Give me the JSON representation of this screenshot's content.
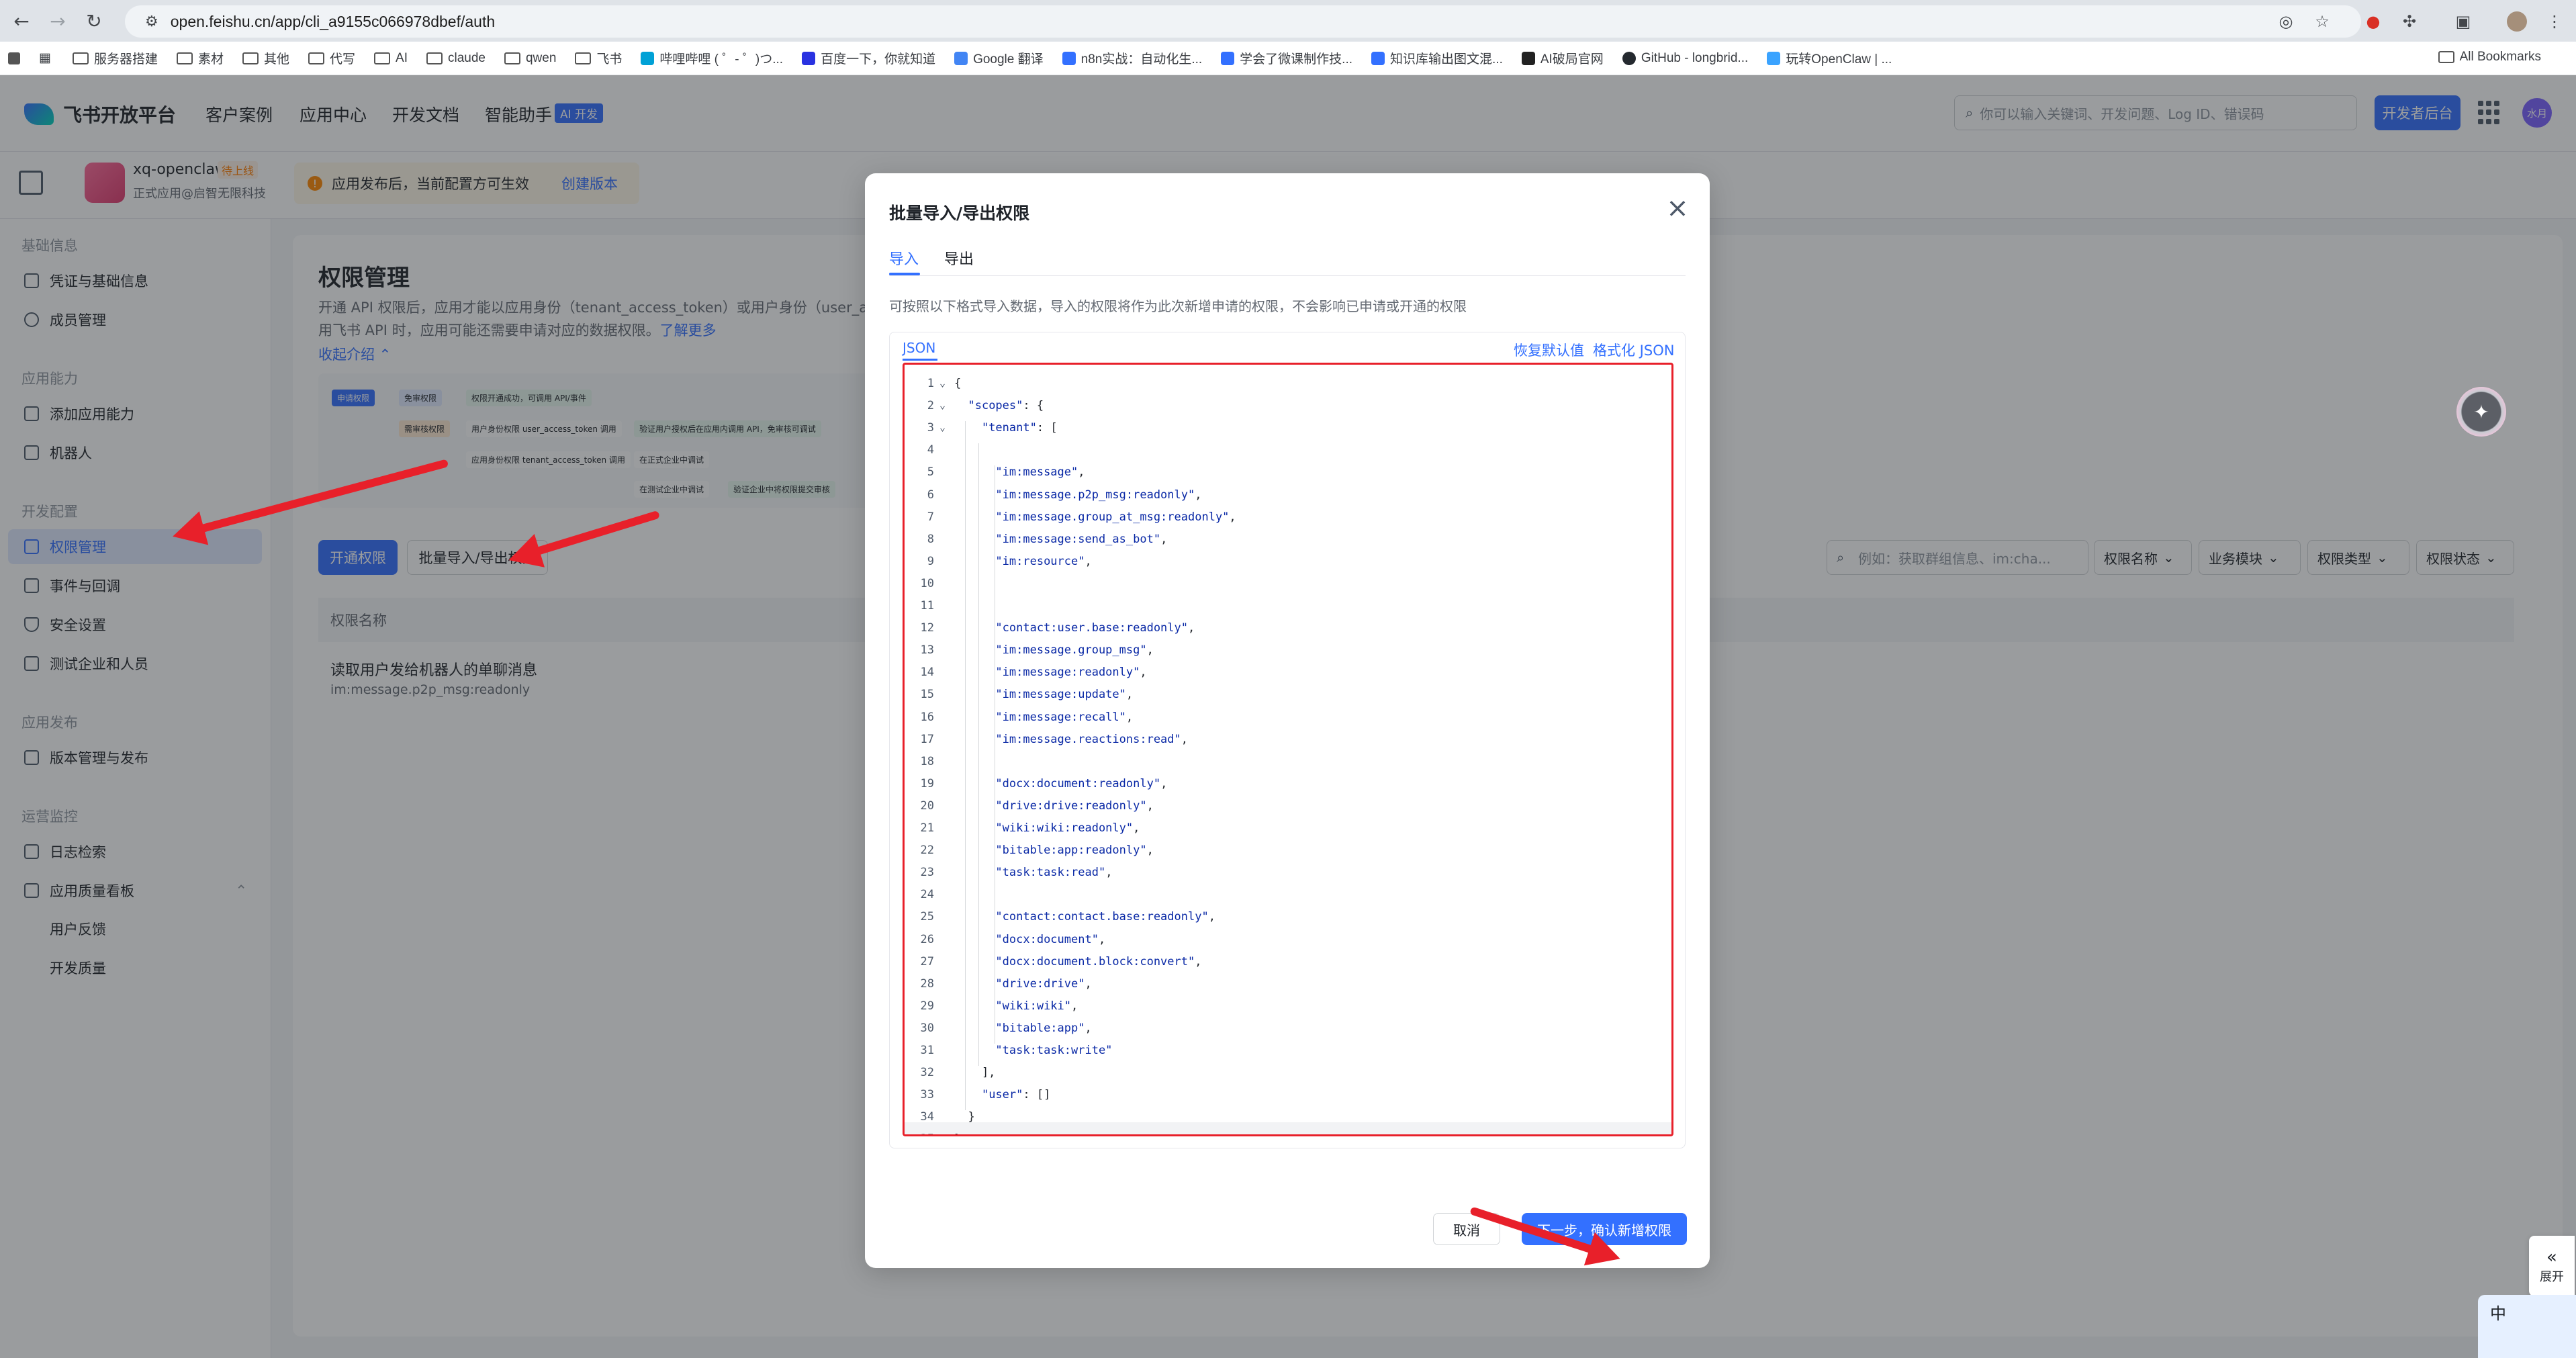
{
  "browser": {
    "url": "open.feishu.cn/app/cli_a9155c066978dbef/auth",
    "bookmarks": [
      "服务器搭建",
      "素材",
      "其他",
      "代写",
      "AI",
      "claude",
      "qwen",
      "飞书",
      "哔哩哔哩 ( ゜- ゜)つ...",
      "百度一下，你就知道",
      "Google 翻译",
      "n8n实战：自动化生...",
      "学会了微课制作技...",
      "知识库输出图文混...",
      "AI破局官网",
      "GitHub - longbrid...",
      "玩转OpenClaw | ..."
    ],
    "all_bookmarks": "All Bookmarks"
  },
  "header": {
    "brand": "飞书开放平台",
    "nav": [
      "客户案例",
      "应用中心",
      "开发文档",
      "智能助手"
    ],
    "ai_badge": "AI 开发",
    "search_placeholder": "你可以输入关键词、开发问题、Log ID、错误码",
    "dev_console": "开发者后台",
    "avatar_text": "水月"
  },
  "appbar": {
    "app_name": "xq-openclaw",
    "status": "待上线",
    "app_sub": "正式应用@启智无限科技",
    "banner_text": "应用发布后，当前配置方可生效",
    "banner_link": "创建版本"
  },
  "sidebar": {
    "groups": [
      {
        "title": "基础信息",
        "items": [
          "凭证与基础信息",
          "成员管理"
        ]
      },
      {
        "title": "应用能力",
        "items": [
          "添加应用能力",
          "机器人"
        ]
      },
      {
        "title": "开发配置",
        "items": [
          "权限管理",
          "事件与回调",
          "安全设置",
          "测试企业和人员"
        ]
      },
      {
        "title": "应用发布",
        "items": [
          "版本管理与发布"
        ]
      },
      {
        "title": "运营监控",
        "items": [
          "日志检索",
          "应用质量看板"
        ]
      }
    ],
    "sub_items": [
      "用户反馈",
      "开发质量"
    ],
    "active": "权限管理"
  },
  "main": {
    "title": "权限管理",
    "desc1": "开通 API 权限后，应用才能以应用身份（tenant_access_token）或用户身份（user_access_token）调用",
    "desc2": "用飞书 API 时，应用可能还需要申请对应的数据权限。",
    "learn_more": "了解更多",
    "collapse": "收起介绍 ⌃",
    "flow_tags": [
      "申请权限",
      "免审权限",
      "权限开通成功，可调用 API/事件",
      "需审核权限",
      "用户身份权限 user_access_token 调用",
      "应用身份权限 tenant_access_token 调用",
      "验证用户授权后在应用内调用 API，免审核可调试",
      "在正式企业中调试",
      "在测试企业中调试",
      "验证企业中将权限提交审核"
    ],
    "btn_open": "开通权限",
    "btn_batch": "批量导入/导出权限",
    "filter_placeholder": "例如：获取群组信息、im:cha...",
    "filters": [
      "权限名称",
      "业务模块",
      "权限类型",
      "权限状态"
    ],
    "table_header": "权限名称",
    "row1_title": "读取用户发给机器人的单聊消息",
    "row1_sub": "im:message.p2p_msg:readonly"
  },
  "modal": {
    "title": "批量导入/导出权限",
    "tabs": [
      "导入",
      "导出"
    ],
    "desc": "可按照以下格式导入数据，导入的权限将作为此次新增申请的权限，不会影响已申请或开通的权限",
    "editor_tab": "JSON",
    "restore_default": "恢复默认值",
    "format_json": "格式化 JSON",
    "code_lines": [
      "{",
      "  \"scopes\": {",
      "    \"tenant\": [",
      "",
      "      \"im:message\",",
      "      \"im:message.p2p_msg:readonly\",",
      "      \"im:message.group_at_msg:readonly\",",
      "      \"im:message:send_as_bot\",",
      "      \"im:resource\",",
      "",
      "",
      "      \"contact:user.base:readonly\",",
      "      \"im:message.group_msg\",",
      "      \"im:message:readonly\",",
      "      \"im:message:update\",",
      "      \"im:message:recall\",",
      "      \"im:message.reactions:read\",",
      "",
      "      \"docx:document:readonly\",",
      "      \"drive:drive:readonly\",",
      "      \"wiki:wiki:readonly\",",
      "      \"bitable:app:readonly\",",
      "      \"task:task:read\",",
      "",
      "      \"contact:contact.base:readonly\",",
      "      \"docx:document\",",
      "      \"docx:document.block:convert\",",
      "      \"drive:drive\",",
      "      \"wiki:wiki\",",
      "      \"bitable:app\",",
      "      \"task:task:write\"",
      "    ],",
      "    \"user\": []",
      "  }",
      "}"
    ],
    "cancel": "取消",
    "next": "下一步，确认新增权限"
  },
  "widgets": {
    "expand": "展开",
    "ime": "中"
  },
  "colors": {
    "accent": "#3370ff",
    "annotation_red": "#e8202a"
  }
}
